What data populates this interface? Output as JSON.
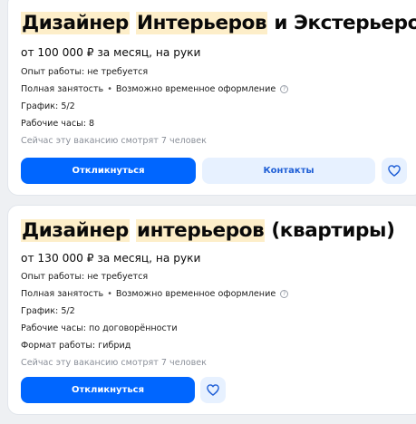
{
  "vacancies": [
    {
      "title_parts": [
        "Дизайнер",
        " ",
        "Интерьеров",
        " и Экстерьеров"
      ],
      "salary": "от 100 000 ₽ за месяц, на руки",
      "experience": "Опыт работы: не требуется",
      "employment": "Полная занятость",
      "employment_extra": "Возможно временное оформление",
      "schedule": "График: 5/2",
      "hours": "Рабочие часы: 8",
      "viewers": "Сейчас эту вакансию смотрят 7 человек",
      "apply_label": "Откликнуться",
      "contacts_label": "Контакты",
      "dot": "•",
      "help": "?"
    },
    {
      "title_parts": [
        "Дизайнер",
        " ",
        "интерьеров",
        " (квартиры)"
      ],
      "salary": "от 130 000 ₽ за месяц, на руки",
      "experience": "Опыт работы: не требуется",
      "employment": "Полная занятость",
      "employment_extra": "Возможно временное оформление",
      "schedule": "График: 5/2",
      "hours": "Рабочие часы: по договорённости",
      "work_format": "Формат работы: гибрид",
      "viewers": "Сейчас эту вакансию смотрят 7 человек",
      "apply_label": "Откликнуться",
      "dot": "•",
      "help": "?"
    }
  ],
  "colors": {
    "accent": "#0066ff",
    "highlight": "#fdeec9",
    "secondary_bg": "#e7f1ff",
    "muted_text": "#8a8f99"
  },
  "icons": {
    "favorite": "heart-outline-icon",
    "help": "question-circle-icon"
  }
}
